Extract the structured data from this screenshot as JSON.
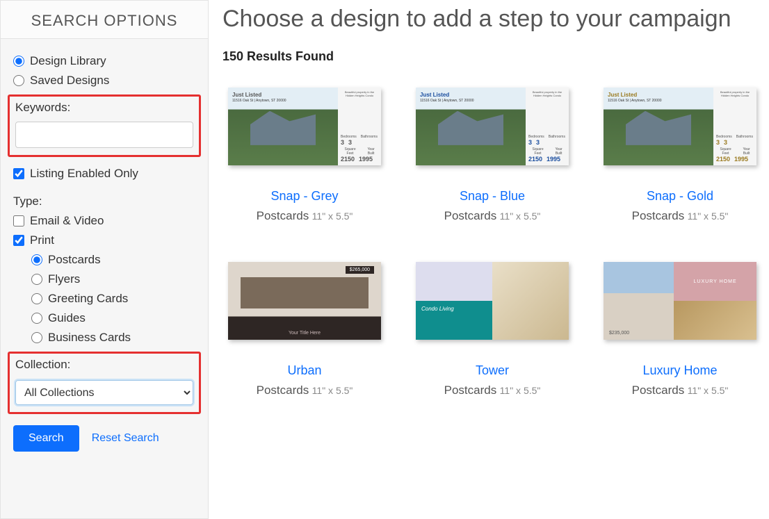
{
  "sidebar": {
    "header": "SEARCH OPTIONS",
    "source": {
      "design_library": "Design Library",
      "saved_designs": "Saved Designs"
    },
    "keywords_label": "Keywords:",
    "keywords_value": "",
    "listing_enabled": "Listing Enabled Only",
    "type_label": "Type:",
    "types": {
      "email_video": "Email & Video",
      "print": "Print"
    },
    "print_subtypes": {
      "postcards": "Postcards",
      "flyers": "Flyers",
      "greeting_cards": "Greeting Cards",
      "guides": "Guides",
      "business_cards": "Business Cards"
    },
    "collection_label": "Collection:",
    "collection_selected": "All Collections",
    "search_button": "Search",
    "reset_link": "Reset Search"
  },
  "main": {
    "title": "Choose a design to add a step to your campaign",
    "results": "150 Results Found"
  },
  "snap": {
    "banner": "Just Listed",
    "address": "11516 Oak St | Anytown, ST 20000",
    "bed": "3",
    "bath": "3",
    "sqft": "2150",
    "year": "1995"
  },
  "cards": [
    {
      "title": "Snap - Grey",
      "type": "Postcards",
      "dim": "11\" x 5.5\""
    },
    {
      "title": "Snap - Blue",
      "type": "Postcards",
      "dim": "11\" x 5.5\""
    },
    {
      "title": "Snap - Gold",
      "type": "Postcards",
      "dim": "11\" x 5.5\""
    },
    {
      "title": "Urban",
      "type": "Postcards",
      "dim": "11\" x 5.5\""
    },
    {
      "title": "Tower",
      "type": "Postcards",
      "dim": "11\" x 5.5\""
    },
    {
      "title": "Luxury Home",
      "type": "Postcards",
      "dim": "11\" x 5.5\""
    }
  ],
  "thumb_text": {
    "urban_price": "$265,000",
    "urban_title": "Your Title Here",
    "tower_condo": "Condo Living",
    "lux_header": "LUXURY HOME",
    "lux_price": "$235,000"
  }
}
